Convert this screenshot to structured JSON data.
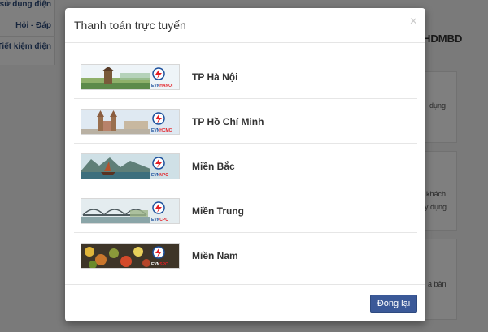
{
  "background": {
    "sidebar": {
      "items": [
        {
          "label": "n sử dụng điện"
        },
        {
          "label": "Hỏi - Đáp"
        },
        {
          "label": "Tiết kiệm điện"
        }
      ]
    },
    "main": {
      "title": "HDMBD",
      "card_texts": [
        "dụng",
        "khách",
        "y dụng",
        "a bản"
      ]
    }
  },
  "modal": {
    "title": "Thanh toán trực tuyến",
    "close_glyph": "×",
    "regions": [
      {
        "name": "TP Hà Nội",
        "logo_text_prefix": "EVN",
        "logo_text_suffix": "HANOI"
      },
      {
        "name": "TP Hồ Chí Minh",
        "logo_text_prefix": "EVN",
        "logo_text_suffix": "HCMC"
      },
      {
        "name": "Miền Bắc",
        "logo_text_prefix": "EVN",
        "logo_text_suffix": "NPC"
      },
      {
        "name": "Miền Trung",
        "logo_text_prefix": "EVN",
        "logo_text_suffix": "CPC"
      },
      {
        "name": "Miền Nam",
        "logo_text_prefix": "EVN",
        "logo_text_suffix": "SPC"
      }
    ],
    "footer": {
      "close_button_label": "Đóng lại"
    }
  },
  "colors": {
    "overlay": "#000000",
    "button_primary": "#3b5998",
    "evn_blue": "#1c4f9c",
    "evn_red": "#e31e24"
  }
}
